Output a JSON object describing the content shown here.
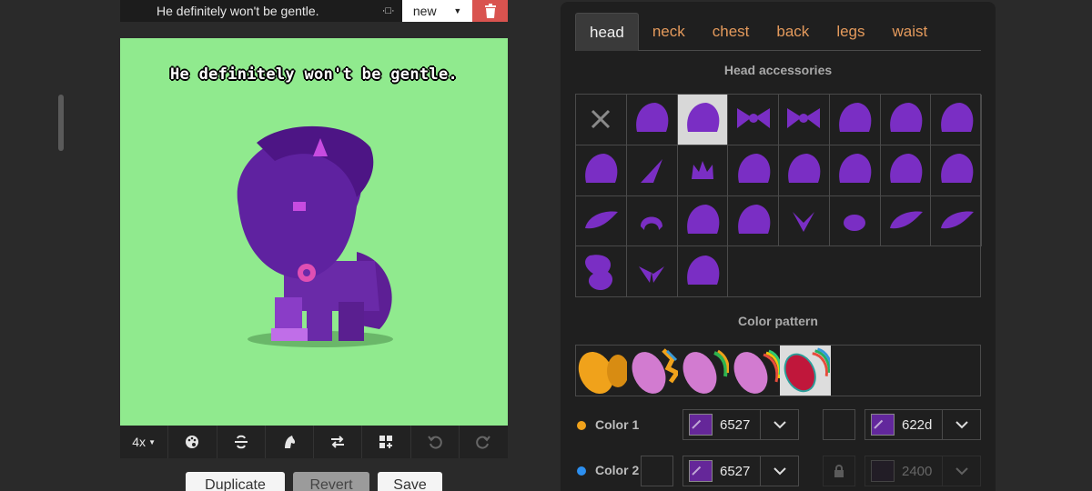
{
  "editor": {
    "name_value": "He definitely won't be gentle.",
    "mode_select": "new",
    "speech_text": "He definitely won't be gentle.",
    "zoom_label": "4x",
    "buttons": {
      "duplicate": "Duplicate",
      "revert": "Revert",
      "save": "Save"
    }
  },
  "tabs": [
    {
      "label": "head",
      "active": true
    },
    {
      "label": "neck"
    },
    {
      "label": "chest"
    },
    {
      "label": "back"
    },
    {
      "label": "legs"
    },
    {
      "label": "waist"
    }
  ],
  "sections": {
    "accessories_title": "Head accessories",
    "pattern_title": "Color pattern"
  },
  "colors": [
    {
      "label": "Color 1",
      "dot": "#f0a21b",
      "value": "6527",
      "swatch": "#652799",
      "second_value": "622d",
      "second_swatch": "#62279c"
    },
    {
      "label": "Color 2",
      "dot": "#2c8ff0",
      "value": "6527",
      "swatch": "#652799",
      "second_value": "2400",
      "second_swatch": "#2a1a33",
      "second_disabled": true
    }
  ],
  "palette": {
    "canvas_bg": "#90ea8e",
    "accent_orange": "#e49a5c",
    "delete_red": "#d9534f",
    "accessory_purple": "#7a2ec4"
  }
}
